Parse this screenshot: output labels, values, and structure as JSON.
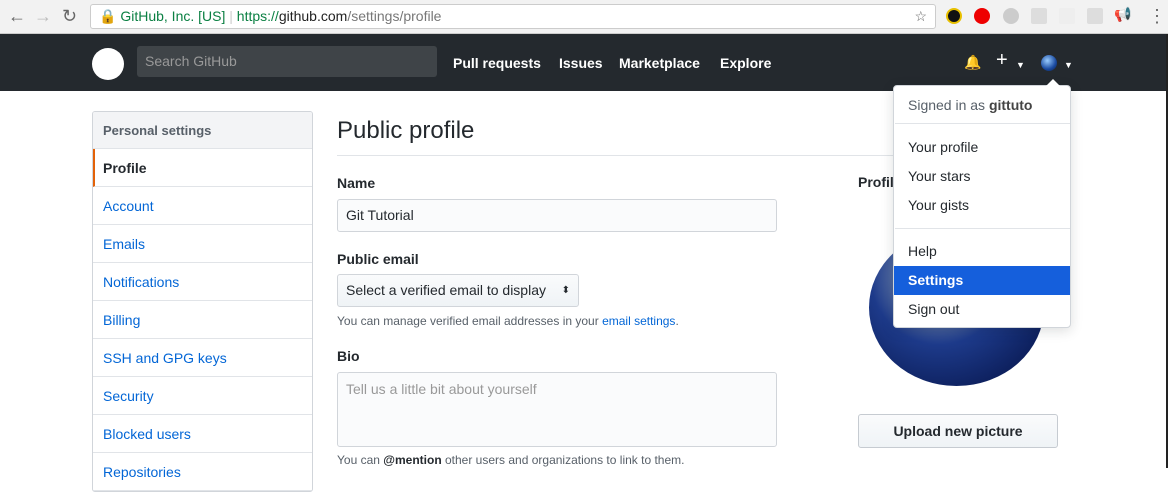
{
  "browser": {
    "security_label": "GitHub, Inc. [US]",
    "url_scheme": "https://",
    "url_host": "github.com",
    "url_path": "/settings/profile"
  },
  "header": {
    "search_placeholder": "Search GitHub",
    "nav": [
      "Pull requests",
      "Issues",
      "Marketplace",
      "Explore"
    ]
  },
  "sidebar": {
    "heading": "Personal settings",
    "items": [
      "Profile",
      "Account",
      "Emails",
      "Notifications",
      "Billing",
      "SSH and GPG keys",
      "Security",
      "Blocked users",
      "Repositories"
    ],
    "active": "Profile"
  },
  "main": {
    "title": "Public profile",
    "name_label": "Name",
    "name_value": "Git Tutorial",
    "email_label": "Public email",
    "email_select": "Select a verified email to display",
    "email_note_prefix": "You can manage verified email addresses in your",
    "email_note_link": "email settings",
    "email_note_suffix": ".",
    "bio_label": "Bio",
    "bio_placeholder": "Tell us a little bit about yourself",
    "bio_note_prefix": "You can",
    "bio_note_mention": "@mention",
    "bio_note_suffix": "other users and organizations to link to them.",
    "picture_label": "Profile picture",
    "upload_button": "Upload new picture"
  },
  "dropdown": {
    "signed_in_prefix": "Signed in as",
    "username": "gittuto",
    "items": [
      "Your profile",
      "Your stars",
      "Your gists",
      "Help",
      "Settings",
      "Sign out"
    ],
    "selected": "Settings"
  },
  "colors": {
    "header": "#24292e",
    "accent": "#155fdc",
    "link": "#0366d6",
    "active_border": "#e36209"
  }
}
